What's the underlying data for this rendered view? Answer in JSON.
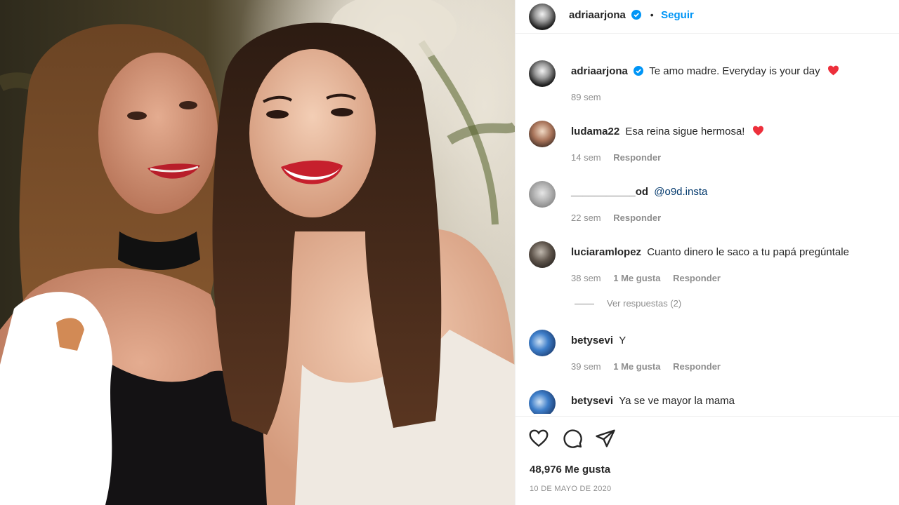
{
  "header": {
    "username": "adriaarjona",
    "separator": "•",
    "follow_label": "Seguir"
  },
  "caption": {
    "username": "adriaarjona",
    "text": "Te amo madre. Everyday is your day",
    "time": "89 sem"
  },
  "comments": [
    {
      "username": "ludama22",
      "text": "Esa reina sigue hermosa!",
      "time": "14 sem",
      "reply_label": "Responder",
      "has_heart": true
    },
    {
      "username": "___________od",
      "mention": "@o9d.insta",
      "time": "22 sem",
      "reply_label": "Responder"
    },
    {
      "username": "luciaramlopez",
      "text": "Cuanto dinero le saco a tu papá pregúntale",
      "time": "38 sem",
      "likes": "1 Me gusta",
      "reply_label": "Responder"
    },
    {
      "username": "betysevi",
      "text": "Y",
      "time": "39 sem",
      "likes": "1 Me gusta",
      "reply_label": "Responder"
    },
    {
      "username": "betysevi",
      "text": "Ya se ve mayor la mama"
    }
  ],
  "view_replies_label": "Ver respuestas (2)",
  "actions": {
    "like_icon": "heart-outline-icon",
    "comment_icon": "comment-bubble-icon",
    "share_icon": "paper-plane-icon"
  },
  "likes_count": "48,976 Me gusta",
  "post_date": "10 DE MAYO DE 2020",
  "colors": {
    "link_blue": "#0095f6",
    "mention_blue": "#00376b",
    "heart_red": "#ed4956",
    "muted_text": "#8e8e8e"
  }
}
